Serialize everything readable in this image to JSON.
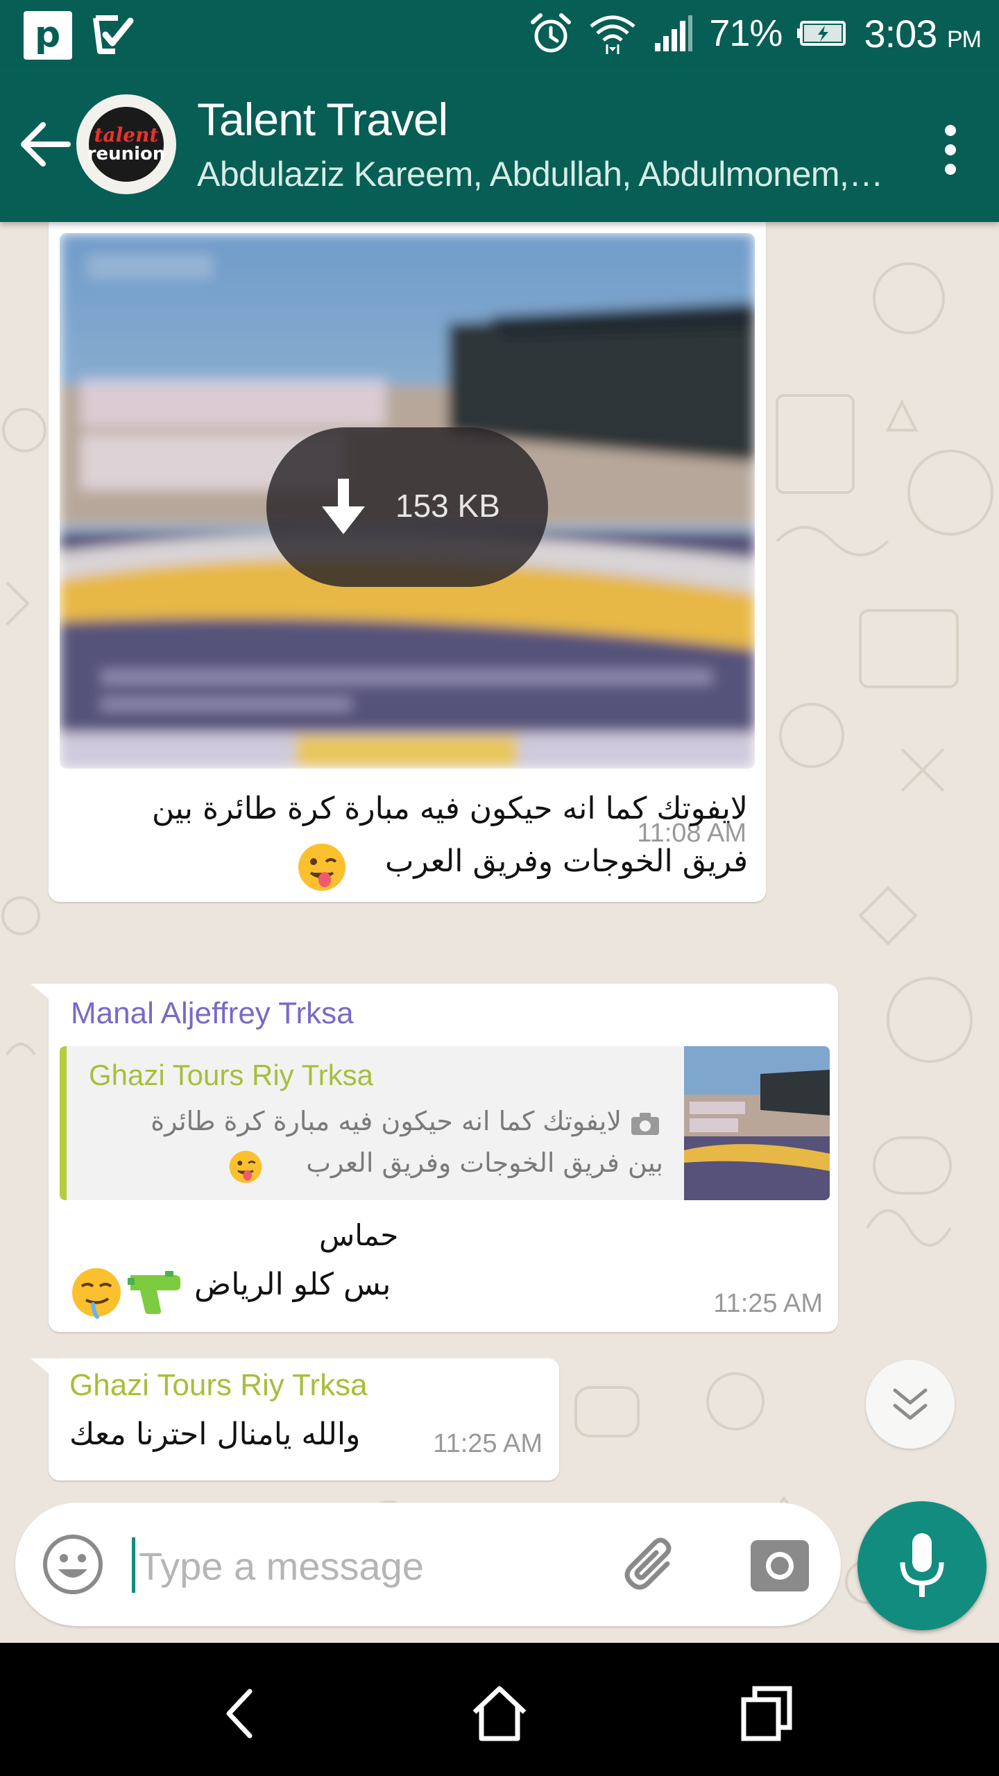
{
  "status_bar": {
    "battery_percent": "71%",
    "time": "3:03",
    "time_suffix": "PM",
    "icons": [
      "p-app-icon",
      "check-task-icon",
      "alarm-icon",
      "wifi-icon",
      "signal-icon",
      "battery-charging-icon"
    ]
  },
  "header": {
    "title": "Talent Travel",
    "subtitle": "Abdulaziz Kareem, Abdullah, Abdulmonem,…",
    "avatar_logo_line1": "talent",
    "avatar_logo_line2": "reunion"
  },
  "messages": [
    {
      "type": "image",
      "download_size": "153 KB",
      "text_line1": "لايفوتك كما انه حيكون فيه مبارة كرة طائرة بين",
      "text_line2": "فريق الخوجات وفريق العرب",
      "emoji": "winking-tongue-emoji",
      "time": "11:08 AM"
    },
    {
      "type": "reply",
      "sender": "Manal Aljeffrey Trksa",
      "sender_color": "#7b68c8",
      "quoted_sender": "Ghazi Tours Riy Trksa",
      "quoted_line1": "لايفوتك كما انه حيكون فيه مبارة كرة طائرة",
      "quoted_line2": "بين فريق الخوجات وفريق العرب",
      "text_line1": "حماس",
      "text_line2": "بس كلو الرياض",
      "emojis": [
        "drooling-face-emoji",
        "water-pistol-emoji"
      ],
      "time": "11:25 AM"
    },
    {
      "type": "text",
      "sender": "Ghazi Tours Riy Trksa",
      "sender_color": "#a6bf3a",
      "text": "والله يامنال احترنا معك",
      "time": "11:25 AM"
    }
  ],
  "composer": {
    "placeholder": "Type a message"
  },
  "colors": {
    "primary": "#075e54",
    "accent": "#128c7e",
    "chat_background": "#ece5dd"
  }
}
